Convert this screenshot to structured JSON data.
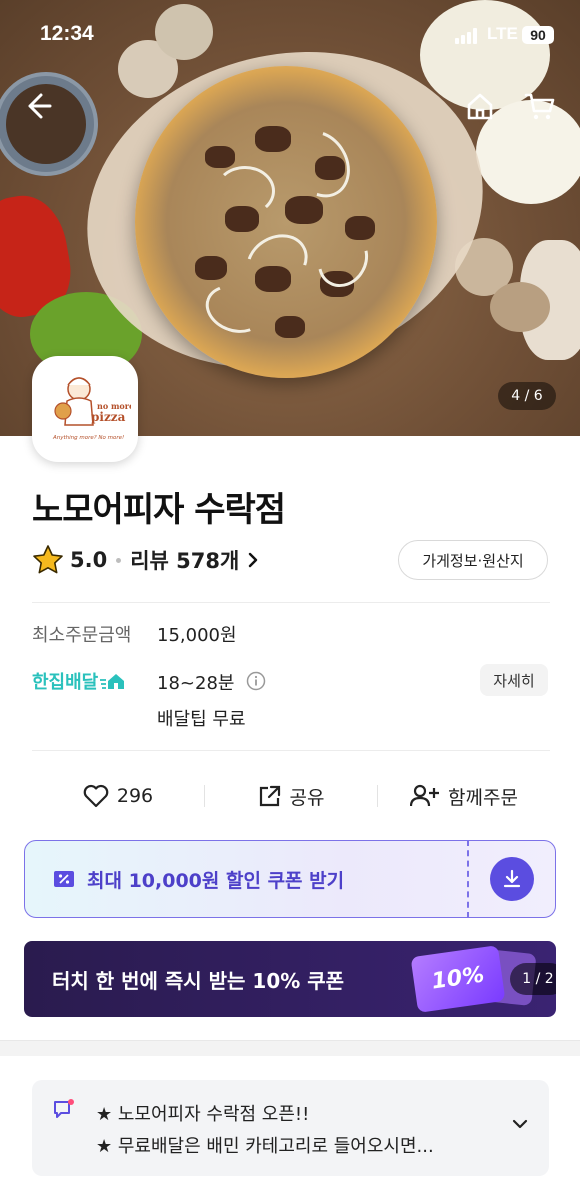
{
  "status_bar": {
    "time": "12:34",
    "network": "LTE",
    "battery": "90"
  },
  "hero": {
    "image_counter": "4 / 6",
    "logo_text_line1": "no more",
    "logo_text_line2": "pizza",
    "logo_text_tagline": "Anything more? No more!"
  },
  "store": {
    "name": "노모어피자 수락점",
    "rating": "5.0",
    "review_label": "리뷰 578개",
    "info_button": "가게정보·원산지"
  },
  "order_info": {
    "min_order_label": "최소주문금액",
    "min_order_value": "15,000원",
    "delivery_type": "한집배달",
    "delivery_time": "18~28분",
    "delivery_tip": "배달팁 무료",
    "detail_button": "자세히"
  },
  "actions": {
    "like_count": "296",
    "share_label": "공유",
    "group_order_label": "함께주문"
  },
  "coupon": {
    "label": "최대 10,000원 할인 쿠폰 받기"
  },
  "banner": {
    "text": "터치 한 번에 즉시 받는 10% 쿠폰",
    "ticket_text": "10%",
    "page_indicator": "1 / 2"
  },
  "notice": {
    "line1": "★ 노모어피자 수락점 오픈!!",
    "line2": "★ 무료배달은 배민 카테고리로 들어오시면..."
  },
  "colors": {
    "brand_mint": "#2ac1bc",
    "coupon_purple": "#5b4de0",
    "banner_dark": "#2a1b4e",
    "star_gold": "#f5b91e"
  }
}
